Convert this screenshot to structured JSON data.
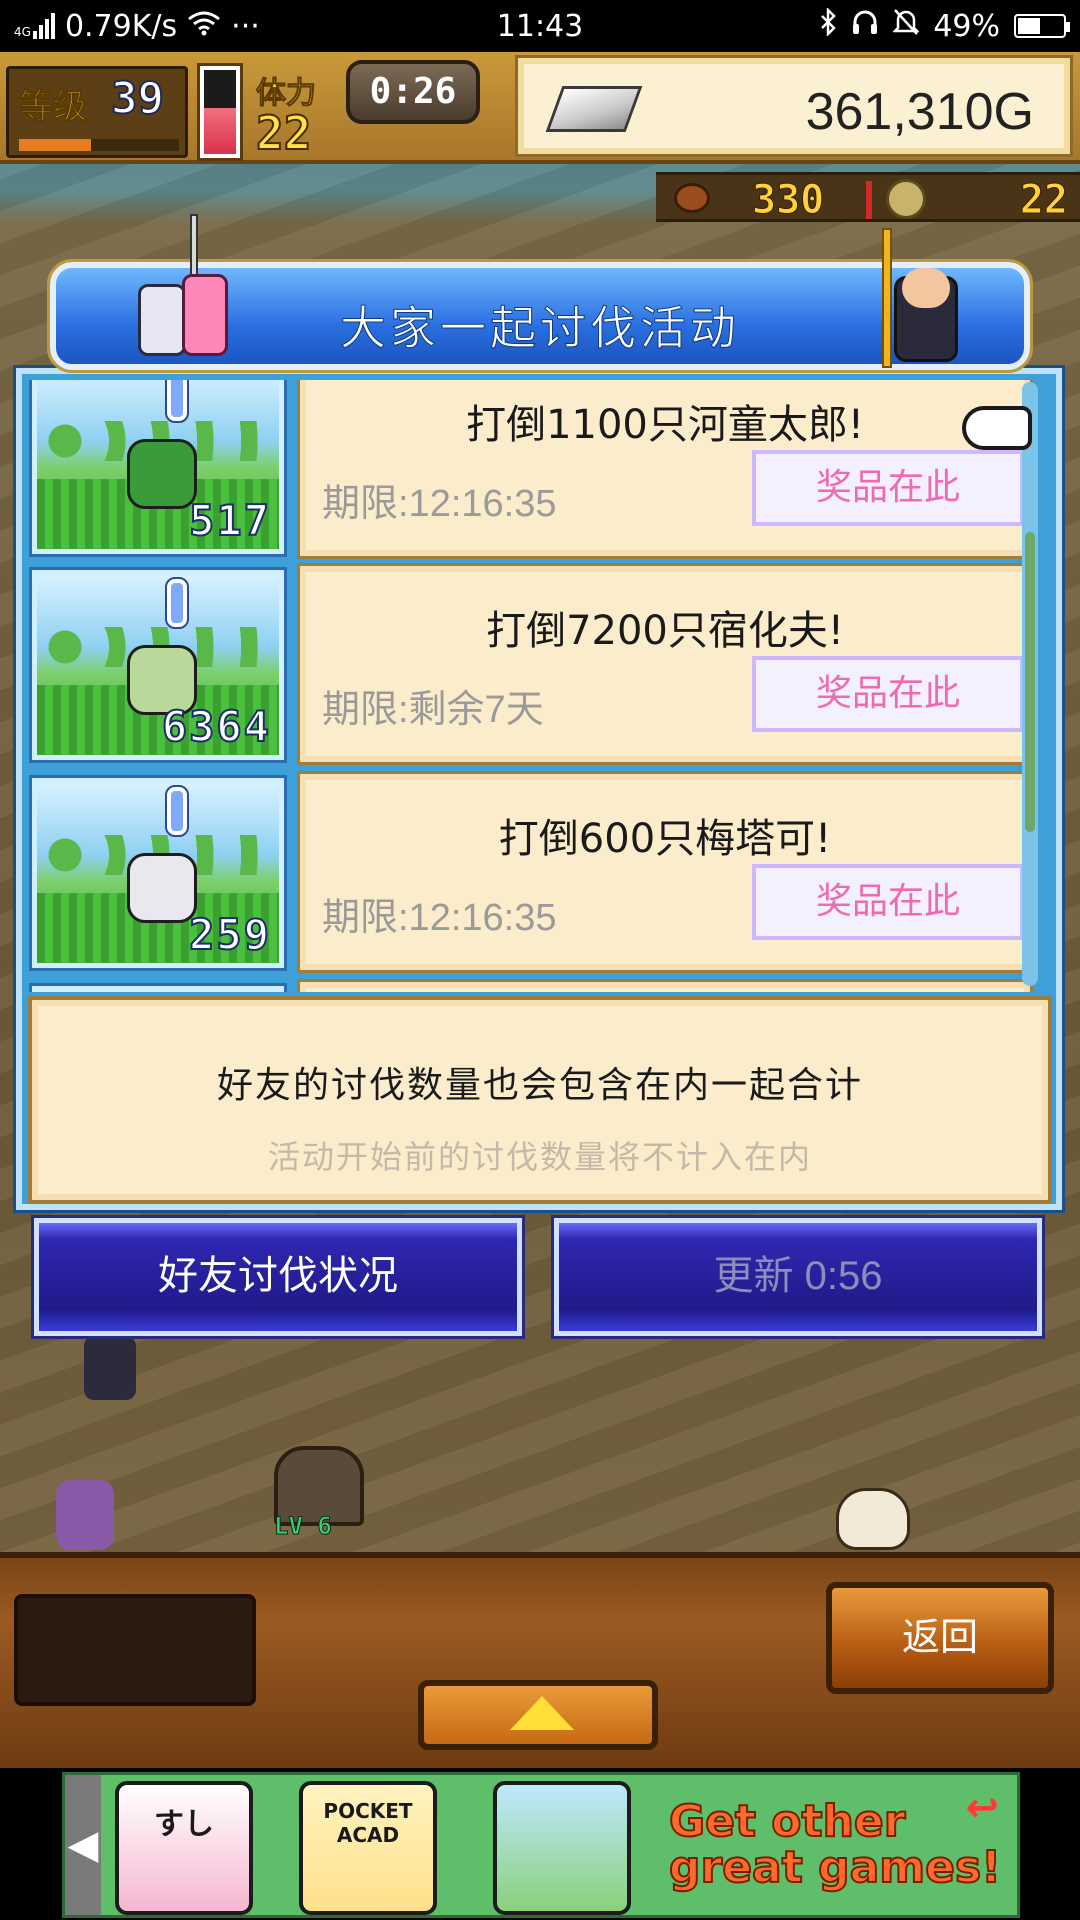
{
  "status_bar": {
    "network": "4G",
    "speed": "0.79K/s",
    "more": "···",
    "time": "11:43",
    "battery": "49%",
    "battery_level": 0.49
  },
  "hud": {
    "level_label": "等级",
    "level": "39",
    "level_progress": 0.45,
    "stamina_label": "体力",
    "stamina": "22",
    "stamina_gauge_level": 0.55,
    "timer": "0:26",
    "gold": "361,310G",
    "food": "330",
    "medals": "22"
  },
  "dialog": {
    "title": "大家一起讨伐活动",
    "quests": [
      {
        "count": "517",
        "title": "打倒1100只河童太郎!",
        "deadline": "期限:12:16:35",
        "reward": "奖品在此",
        "monster_color": "#3a9b3a"
      },
      {
        "count": "6364",
        "title": "打倒7200只宿化夫!",
        "deadline": "期限:剩余7天",
        "reward": "奖品在此",
        "monster_color": "#b8d99a"
      },
      {
        "count": "259",
        "title": "打倒600只梅塔可!",
        "deadline": "期限:12:16:35",
        "reward": "奖品在此",
        "monster_color": "#e8e8ee"
      }
    ],
    "info_main": "好友的讨伐数量也会包含在内一起合计",
    "info_sub": "活动开始前的讨伐数量将不计入在内",
    "btn_friends": "好友讨伐状况",
    "btn_refresh": "更新 0:56"
  },
  "scene": {
    "chest_level": "LV 6"
  },
  "bottom": {
    "return_label": "返回"
  },
  "ad": {
    "tile1": "すし",
    "tile2": "POCKET ACAD",
    "tile3": "",
    "text": "Get other great games!",
    "arrow": "↩"
  },
  "colors": {
    "dialog_blue": "#3ea0d8",
    "card_bg": "#fbeccb",
    "reward_pink": "#f06ab0",
    "button_navy": "#1f1a8a"
  }
}
